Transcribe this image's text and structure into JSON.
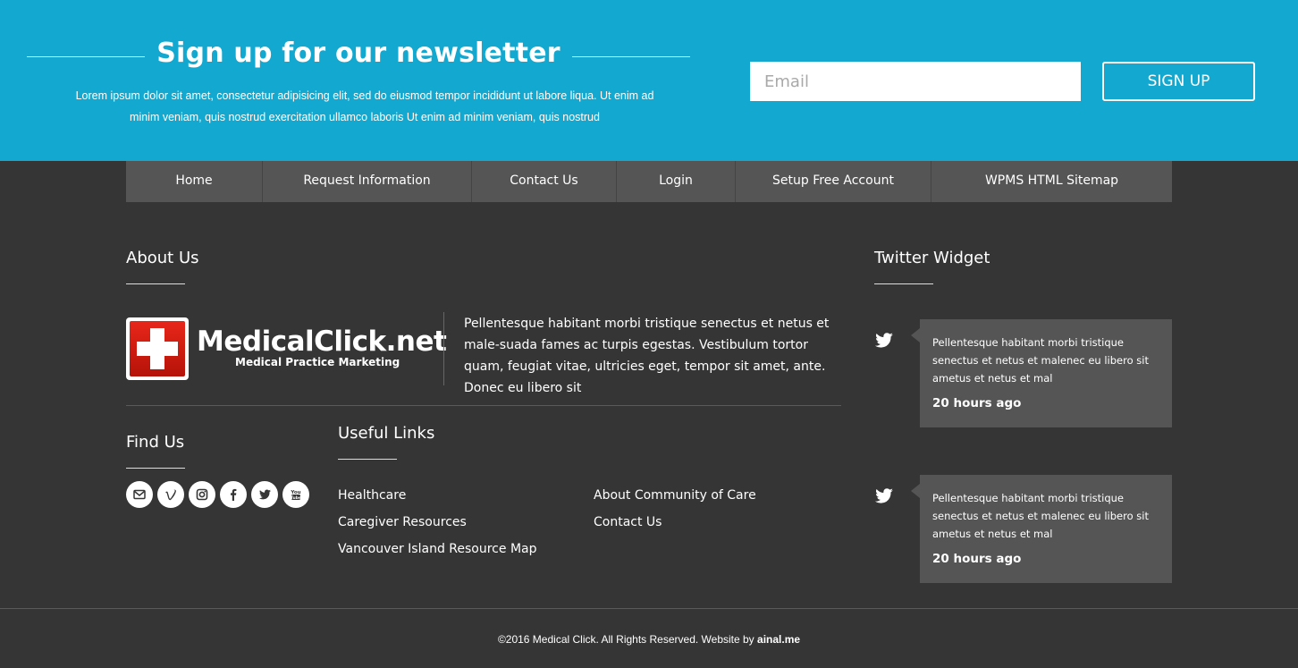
{
  "newsletter": {
    "title": "Sign up for our newsletter",
    "description_line1": "Lorem ipsum dolor sit amet, consectetur adipisicing elit, sed do eiusmod tempor incididunt ut labore liqua. Ut enim ad",
    "description_line2": "minim veniam, quis nostrud exercitation ullamco laboris Ut enim ad minim veniam, quis nostrud",
    "email_placeholder": "Email",
    "email_value": "",
    "signup_label": "SIGN UP"
  },
  "nav": {
    "items": [
      {
        "label": "Home"
      },
      {
        "label": "Request Information"
      },
      {
        "label": "Contact Us"
      },
      {
        "label": "Login"
      },
      {
        "label": "Setup Free Account"
      },
      {
        "label": "WPMS HTML Sitemap"
      }
    ]
  },
  "about": {
    "heading": "About Us",
    "logo_name": "MedicalClick.net",
    "logo_tagline": "Medical Practice Marketing",
    "text": "Pellentesque habitant morbi tristique senectus et netus et male-suada fames ac turpis egestas. Vestibulum tortor quam, feugiat vitae, ultricies eget, tempor sit amet, ante. Donec eu libero sit"
  },
  "find_us": {
    "heading": "Find Us",
    "icons": [
      "email-icon",
      "vimeo-icon",
      "instagram-icon",
      "facebook-icon",
      "twitter-icon",
      "youtube-icon"
    ]
  },
  "useful_links": {
    "heading": "Useful Links",
    "col1": [
      "Healthcare",
      "Caregiver Resources",
      "Vancouver Island Resource Map"
    ],
    "col2": [
      "About Community of Care",
      "Contact Us"
    ]
  },
  "twitter_widget": {
    "heading": "Twitter Widget",
    "tweets": [
      {
        "text": "Pellentesque habitant morbi tristique senectus et netus et malenec eu libero sit ametus et netus et mal",
        "time": "20 hours ago"
      },
      {
        "text": "Pellentesque habitant morbi tristique senectus et netus et malenec eu libero sit ametus et netus et mal",
        "time": "20 hours ago"
      }
    ]
  },
  "footer": {
    "copyright": "©2016 Medical Click. All Rights Reserved. Website by ",
    "credit": "ainal.me"
  },
  "colors": {
    "newsletter_bg": "#13a8cf",
    "page_bg": "#353535",
    "nav_bg": "#555555",
    "logo_red": "#d01e12"
  }
}
